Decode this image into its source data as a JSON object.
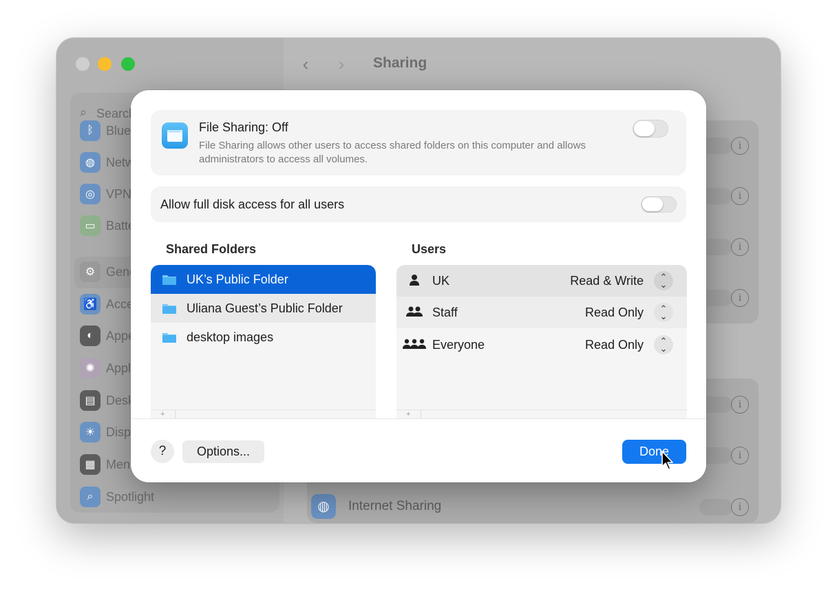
{
  "window": {
    "title": "Sharing",
    "nav_back": "‹",
    "nav_forward": "›",
    "search_placeholder": "Search",
    "sidebar_items": [
      {
        "label": "Bluetooth",
        "icon": "bluetooth-icon",
        "color": "#2c7be5"
      },
      {
        "label": "Network",
        "icon": "globe-icon",
        "color": "#2c7be5"
      },
      {
        "label": "VPN",
        "icon": "vpn-icon",
        "color": "#2c7be5"
      },
      {
        "label": "Battery",
        "icon": "battery-icon",
        "color": "#4cb84a"
      },
      {
        "label": "General",
        "icon": "gear-icon",
        "color": "#8e8e93"
      },
      {
        "label": "Accessibility",
        "icon": "accessibility-icon",
        "color": "#2c7be5"
      },
      {
        "label": "Appearance",
        "icon": "appearance-icon",
        "color": "#1d1d1f"
      },
      {
        "label": "Apple Intelligence",
        "icon": "apple-intelligence-icon",
        "color": "#d946b8"
      },
      {
        "label": "Desktop & Dock",
        "icon": "desktop-icon",
        "color": "#1d1d1f"
      },
      {
        "label": "Displays",
        "icon": "displays-icon",
        "color": "#2c7be5"
      },
      {
        "label": "Menu Bar",
        "icon": "menu-bar-icon",
        "color": "#1d1d1f"
      },
      {
        "label": "Spotlight",
        "icon": "spotlight-icon",
        "color": "#2c7be5"
      }
    ],
    "internet_sharing_label": "Internet Sharing"
  },
  "file_sharing": {
    "title": "File Sharing: Off",
    "description": "File Sharing allows other users to access shared folders on this computer and allows administrators to access all volumes.",
    "enabled": false
  },
  "full_disk_access": {
    "label": "Allow full disk access for all users",
    "enabled": false
  },
  "shared_folders": {
    "title": "Shared Folders",
    "items": [
      {
        "label": "UK’s Public Folder",
        "selected": true
      },
      {
        "label": "Uliana Guest’s Public Folder",
        "selected": false
      },
      {
        "label": "desktop images",
        "selected": false
      }
    ]
  },
  "users": {
    "title": "Users",
    "items": [
      {
        "name": "UK",
        "permission": "Read & Write",
        "icon": "person-icon"
      },
      {
        "name": "Staff",
        "permission": "Read Only",
        "icon": "group-icon"
      },
      {
        "name": "Everyone",
        "permission": "Read Only",
        "icon": "everyone-icon"
      }
    ]
  },
  "footer": {
    "help_label": "?",
    "options_label": "Options...",
    "done_label": "Done"
  },
  "colors": {
    "accent": "#1479f0",
    "selected_row": "#0a64d8",
    "folder": "#4ab3f4"
  }
}
